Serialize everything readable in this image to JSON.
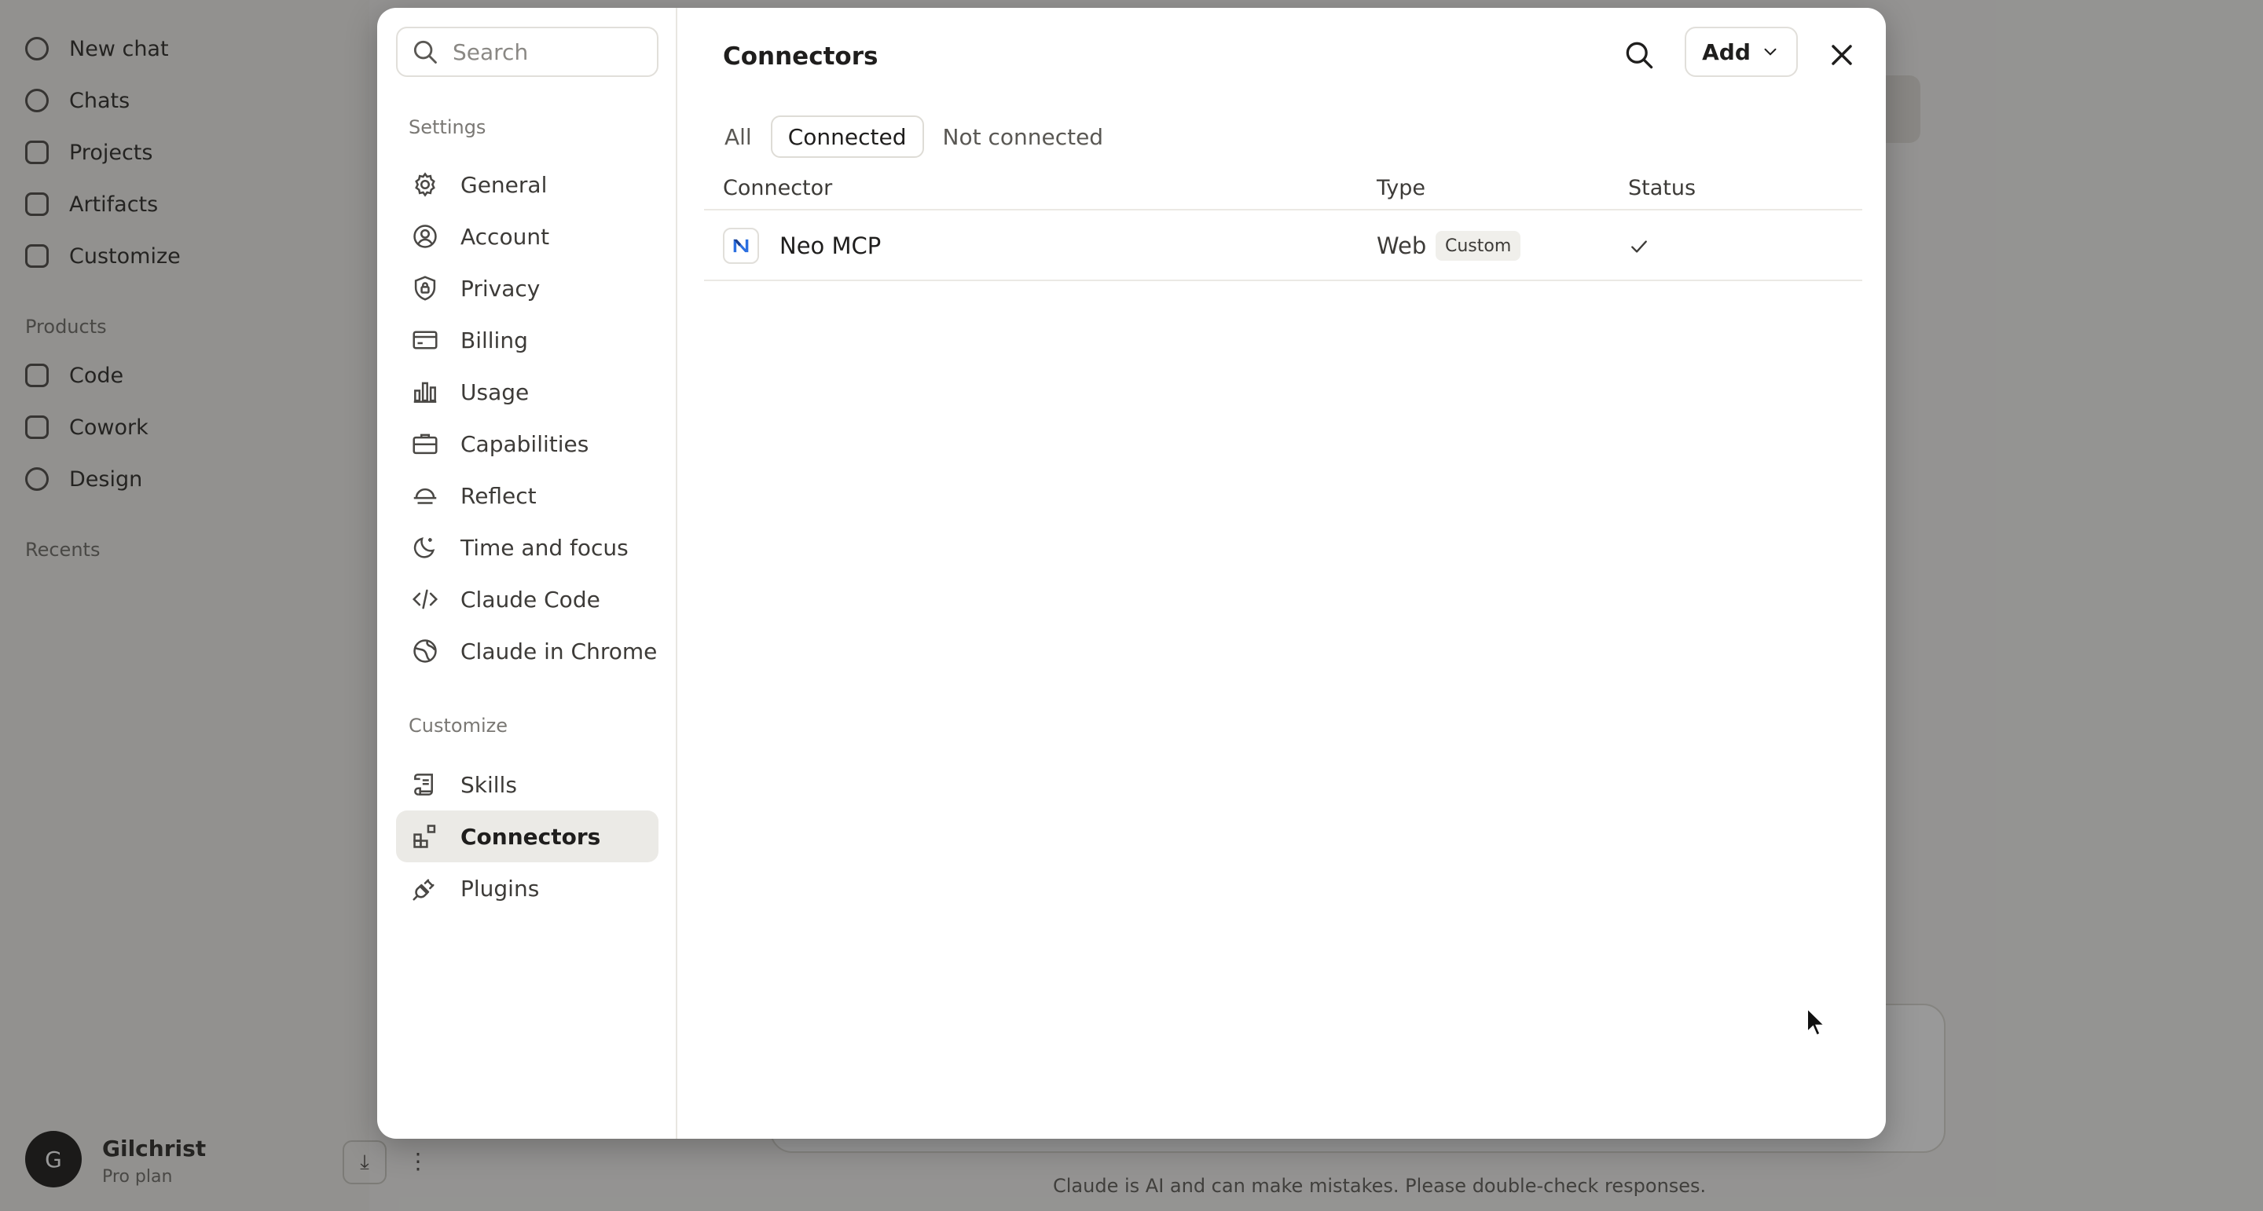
{
  "background": {
    "nav_items": [
      "New chat",
      "Chats",
      "Projects",
      "Artifacts",
      "Customize"
    ],
    "products_label": "Products",
    "product_items": [
      "Code",
      "Cowork",
      "Design"
    ],
    "recents_label": "Recents",
    "user_initial": "G",
    "user_name": "Gilchrist",
    "user_plan": "Pro plan",
    "footer_disclaimer": "Claude is AI and can make mistakes. Please double-check responses."
  },
  "settings": {
    "search_placeholder": "Search",
    "settings_label": "Settings",
    "settings_items": [
      {
        "label": "General",
        "icon": "gear-icon"
      },
      {
        "label": "Account",
        "icon": "user-circle-icon"
      },
      {
        "label": "Privacy",
        "icon": "shield-lock-icon"
      },
      {
        "label": "Billing",
        "icon": "credit-card-icon"
      },
      {
        "label": "Usage",
        "icon": "bar-chart-icon"
      },
      {
        "label": "Capabilities",
        "icon": "briefcase-icon"
      },
      {
        "label": "Reflect",
        "icon": "sunset-icon"
      },
      {
        "label": "Time and focus",
        "icon": "moon-icon"
      },
      {
        "label": "Claude Code",
        "icon": "code-icon"
      },
      {
        "label": "Claude in Chrome",
        "icon": "globe-icon"
      }
    ],
    "customize_label": "Customize",
    "customize_items": [
      {
        "label": "Skills",
        "icon": "scroll-icon"
      },
      {
        "label": "Connectors",
        "icon": "blocks-icon",
        "active": true
      },
      {
        "label": "Plugins",
        "icon": "plug-icon"
      }
    ]
  },
  "connectors": {
    "title": "Connectors",
    "add_label": "Add",
    "tabs": [
      "All",
      "Connected",
      "Not connected"
    ],
    "active_tab": "Connected",
    "columns": {
      "connector": "Connector",
      "type": "Type",
      "status": "Status"
    },
    "rows": [
      {
        "name": "Neo MCP",
        "type": "Web",
        "badge": "Custom",
        "status": "connected",
        "logo_color": "#2b6fe0"
      }
    ]
  }
}
